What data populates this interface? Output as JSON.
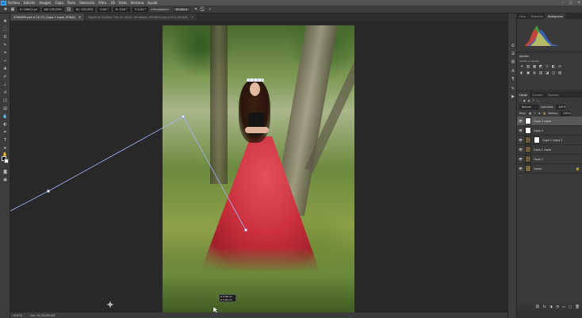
{
  "menu": {
    "app_logo": "Ps",
    "items": [
      "Archivo",
      "Edición",
      "Imagen",
      "Capa",
      "Texto",
      "Selección",
      "Filtro",
      "3D",
      "Vista",
      "Ventana",
      "Ayuda"
    ],
    "window_controls": [
      "–",
      "□",
      "✕"
    ]
  },
  "options": {
    "x_field": "X: 1464,5 px",
    "w_field": "AN: 100,00%",
    "h_field": "AL: 100,00%",
    "angle_field": "0,00 °",
    "h_skew": "H: 0,00 °",
    "v_skew": "V: 0,00 °",
    "interpolation": "Bicúbica",
    "interp_label": "Interpolación:",
    "cancel_icon": "⃠",
    "commit_icon": "✓"
  },
  "tabs": [
    {
      "label": "ZON4859.psd al 16,7% (Capa 2 copia, RGB/8)",
      "close": "×"
    },
    {
      "label": "Nightfork Goldfish Tree Xin White (Bridgiste) ZON4859.jpg al 50% (RGB/8)",
      "close": "×"
    }
  ],
  "status": {
    "zoom": "16,67%",
    "doc": "Doc: 56,1M/189,4M"
  },
  "measure": {
    "line1": "Δ 2,88 cm",
    "line2": "Δ 5,89 cm"
  },
  "panels": {
    "top_tabs": [
      "Color",
      "Muestras",
      "Histograma"
    ],
    "adjust_title": "Ajustes",
    "adjust_sub": "Añadir un ajuste",
    "adjust_icons": [
      "☀",
      "▥",
      "▦",
      "◩",
      "▽",
      "◧",
      "⚖",
      "◐",
      "▣",
      "◍",
      "▤",
      "◪",
      "◫",
      "▧"
    ],
    "layers_tabs": [
      "Capas",
      "Canales",
      "Trazados"
    ],
    "blend_mode": "Normal",
    "opacity_label": "Opacidad:",
    "opacity": "100%",
    "fill_label": "Relleno:",
    "fill": "100%",
    "lock_label": "Bloq.:",
    "layers": [
      {
        "name": "Capa 2 copia",
        "selected": true,
        "thumb": "#ffffff",
        "has_mask": false
      },
      {
        "name": "Capa 2",
        "selected": false,
        "thumb": "#ffffff",
        "has_mask": false
      },
      {
        "name": "Capa 1 copia 2",
        "selected": false,
        "thumb": "#6a5a3c",
        "has_mask": true
      },
      {
        "name": "Capa 1 copia",
        "selected": false,
        "thumb": "#6a5a3c",
        "has_mask": false
      },
      {
        "name": "Capa 1",
        "selected": false,
        "thumb": "#6a5a3c",
        "has_mask": false
      },
      {
        "name": "Fondo",
        "selected": false,
        "thumb": "#7a6a44",
        "has_mask": false,
        "locked": true
      }
    ],
    "footer_icons": [
      "⛓",
      "fx",
      "◑",
      "◔",
      "▭",
      "▢",
      "🗑"
    ]
  }
}
